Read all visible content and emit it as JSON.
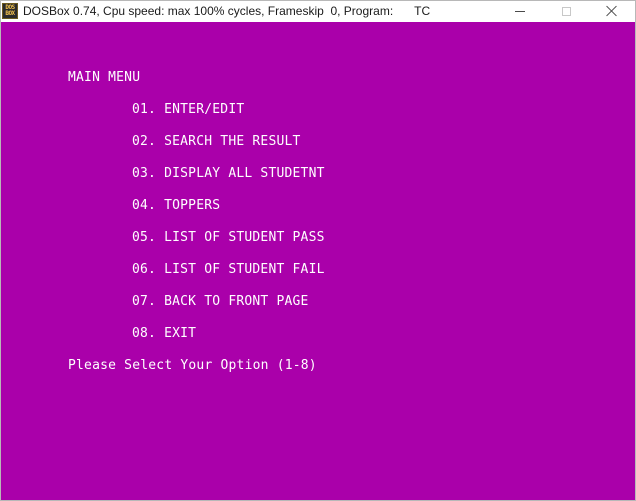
{
  "window": {
    "title": "DOSBox 0.74, Cpu speed: max 100% cycles, Frameskip  0, Program:",
    "program": "TC",
    "icon_lines": [
      "DOS",
      "BOX"
    ],
    "icon": "dosbox-icon"
  },
  "colors": {
    "screen_background": "#aa00aa",
    "screen_text": "#ffffff"
  },
  "screen": {
    "heading": "MAIN MENU",
    "menu_items": [
      "01. ENTER/EDIT",
      "02. SEARCH THE RESULT",
      "03. DISPLAY ALL STUDETNT",
      "04. TOPPERS",
      "05. LIST OF STUDENT PASS",
      "06. LIST OF STUDENT FAIL",
      "07. BACK TO FRONT PAGE",
      "08. EXIT"
    ],
    "prompt": "Please Select Your Option (1-8)"
  }
}
